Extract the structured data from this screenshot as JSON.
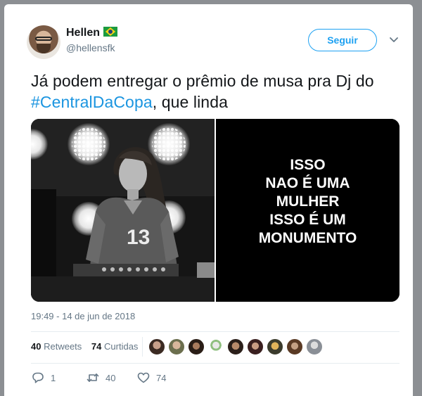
{
  "author": {
    "name": "Hellen",
    "handle": "@hellensfk",
    "flag_icon": "brazil-flag-icon"
  },
  "follow_button": {
    "label": "Seguir"
  },
  "menu_icon": "chevron-down-icon",
  "tweet": {
    "text_before": "Já podem entregar o prêmio de musa pra Dj do ",
    "hashtag": "#CentralDaCopa",
    "text_after": ", que linda"
  },
  "media": {
    "jersey_number": "13",
    "meme_lines": [
      "ISSO",
      "NAO É UMA",
      "MULHER",
      "ISSO É UM",
      "MONUMENTO"
    ]
  },
  "timestamp": "19:49 - 14 de jun de 2018",
  "stats": {
    "retweets_count": "40",
    "retweets_label": "Retweets",
    "likes_count": "74",
    "likes_label": "Curtidas"
  },
  "actions": {
    "reply_count": "1",
    "retweet_count": "40",
    "like_count": "74"
  },
  "colors": {
    "accent": "#1da1f2",
    "hashtag": "#1b95e0",
    "muted": "#657786"
  }
}
